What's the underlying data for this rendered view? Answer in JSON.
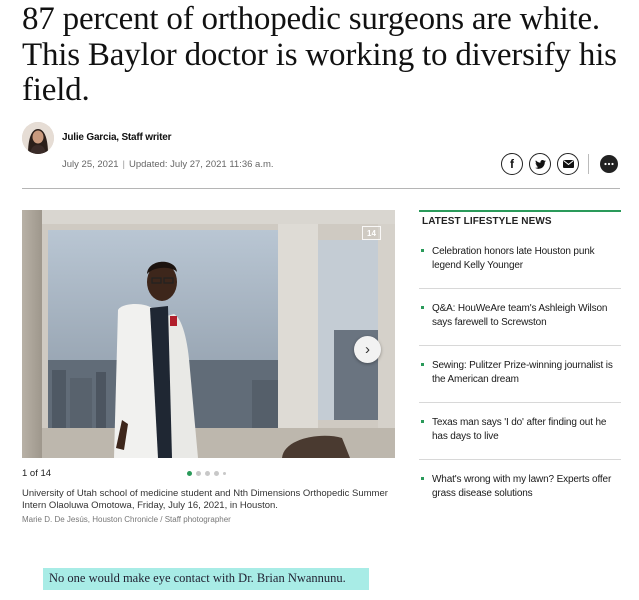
{
  "article": {
    "headline": "87 percent of orthopedic surgeons are white. This Baylor doctor is working to diversify his field.",
    "author": "Julie Garcia, Staff writer",
    "published": "July 25, 2021",
    "updated": "Updated: July 27, 2021 11:36 a.m.",
    "pull_quote": "No one would make eye contact with Dr. Brian Nwannunu."
  },
  "share": {
    "facebook_icon": "facebook-icon",
    "twitter_icon": "twitter-icon",
    "email_icon": "email-icon",
    "comments_icon": "comments-icon"
  },
  "gallery": {
    "counter": "1 of 14",
    "badge": "14",
    "caption": "University of Utah school of medicine student and Nth Dimensions Orthopedic Summer Intern Olaoluwa Omotowa, Friday, July 16, 2021, in Houston.",
    "credit": "Marie D. De Jesús, Houston Chronicle / Staff photographer",
    "next_icon": "chevron-right-icon",
    "total_dots": 5,
    "active_dot": 0
  },
  "sidebar": {
    "title": "LATEST LIFESTYLE NEWS",
    "items": [
      "Celebration honors late Houston punk legend Kelly Younger",
      "Q&A: HouWeAre team's Ashleigh Wilson says farewell to Screwston",
      "Sewing: Pulitzer Prize-winning journalist is the American dream",
      "Texas man says 'I do' after finding out he has days to live",
      "What's wrong with my lawn? Experts offer grass disease solutions"
    ]
  },
  "colors": {
    "accent": "#2a9a5a",
    "highlight": "#a8ece6"
  }
}
